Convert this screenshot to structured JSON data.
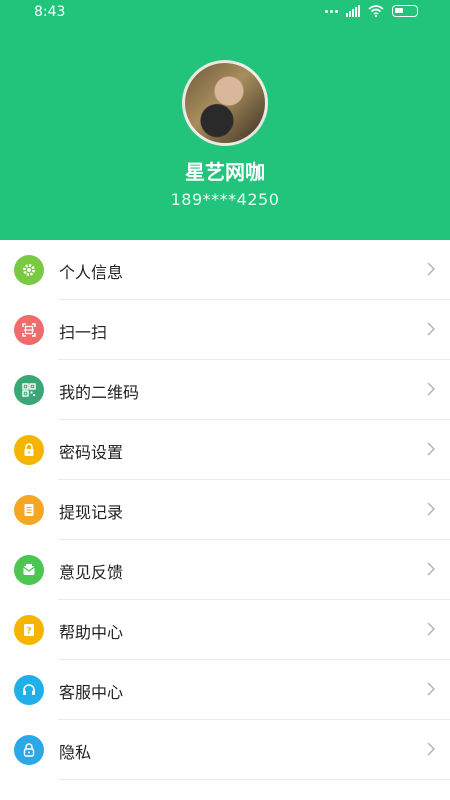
{
  "status_bar": {
    "time": "8:43"
  },
  "profile": {
    "name": "星艺网咖",
    "phone": "189****4250"
  },
  "menu": [
    {
      "label": "个人信息",
      "icon": "gear-icon",
      "color": "#7ac943"
    },
    {
      "label": "扫一扫",
      "icon": "scan-icon",
      "color": "#f06b6b"
    },
    {
      "label": "我的二维码",
      "icon": "qr-code-icon",
      "color": "#3aa776"
    },
    {
      "label": "密码设置",
      "icon": "lock-icon",
      "color": "#f5b400"
    },
    {
      "label": "提现记录",
      "icon": "document-icon",
      "color": "#f5a623"
    },
    {
      "label": "意见反馈",
      "icon": "feedback-icon",
      "color": "#4cc552"
    },
    {
      "label": "帮助中心",
      "icon": "help-icon",
      "color": "#f5b400"
    },
    {
      "label": "客服中心",
      "icon": "headset-icon",
      "color": "#1fb0ea"
    },
    {
      "label": "隐私",
      "icon": "privacy-lock-icon",
      "color": "#2aa8e8"
    }
  ]
}
